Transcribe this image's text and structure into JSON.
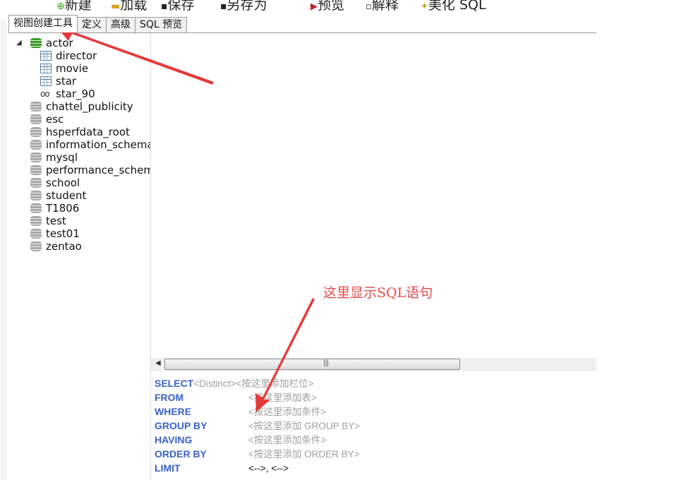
{
  "toolbar": {
    "new_label": "新建",
    "load_label": "加载",
    "save_label": "保存",
    "save_as_label": "另存为",
    "preview_label": "预览",
    "explain_label": "解释",
    "beautify_label": "美化 SQL"
  },
  "tabs": [
    {
      "label": "视图创建工具",
      "active": true
    },
    {
      "label": "定义"
    },
    {
      "label": "高级"
    },
    {
      "label": "SQL 预览"
    }
  ],
  "tree": {
    "expanded_db": {
      "name": "actor",
      "children": [
        {
          "name": "director",
          "icon": "table-icon"
        },
        {
          "name": "movie",
          "icon": "table-icon"
        },
        {
          "name": "star",
          "icon": "table-icon"
        },
        {
          "name": "star_90",
          "icon": "view-icon"
        }
      ]
    },
    "databases": [
      "chattel_publicity",
      "esc",
      "hsperfdata_root",
      "information_schema",
      "mysql",
      "performance_schema",
      "school",
      "student",
      "T1806",
      "test",
      "test01",
      "zentao"
    ]
  },
  "sql_builder": {
    "select": {
      "keyword": "SELECT",
      "distinct": "<Distinct>",
      "placeholder": "<按这里添加栏位>"
    },
    "from": {
      "keyword": "FROM",
      "placeholder": "<按这里添加表>"
    },
    "where": {
      "keyword": "WHERE",
      "placeholder": "<按这里添加条件>"
    },
    "group_by": {
      "keyword": "GROUP BY",
      "placeholder": "<按这里添加 GROUP BY>"
    },
    "having": {
      "keyword": "HAVING",
      "placeholder": "<按这里添加条件>"
    },
    "order_by": {
      "keyword": "ORDER BY",
      "placeholder": "<按这里添加 ORDER BY>"
    },
    "limit": {
      "keyword": "LIMIT",
      "value": "<-->, <-->"
    }
  },
  "annotation": {
    "text": "这里显示SQL语句",
    "color": "#e44a4a"
  },
  "colors": {
    "keyword": "#3a62c6",
    "placeholder": "#a0a0a0",
    "db_connected": "#3a9a2a",
    "db_idle": "#a8a8a8"
  }
}
